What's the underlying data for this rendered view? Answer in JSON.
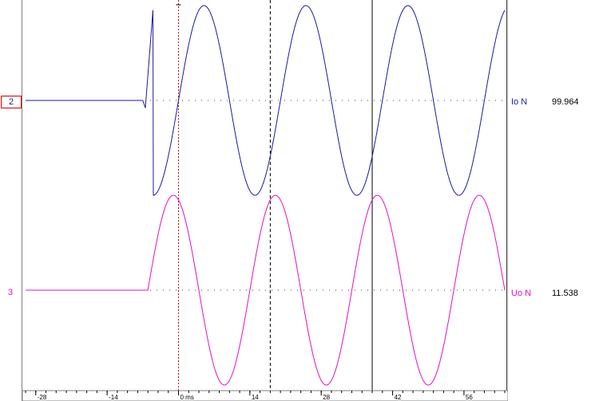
{
  "channels": [
    {
      "number": "2",
      "name": "Io N",
      "value": "99.964",
      "color": "#1a1aa0",
      "selected": true
    },
    {
      "number": "3",
      "name": "Uo N",
      "value": "11.538",
      "color": "#e010c8",
      "selected": false
    }
  ],
  "time_axis": {
    "unit_label": "ms",
    "ticks": [
      "-28",
      "-14",
      "0 ms",
      "14",
      "28",
      "42",
      "56"
    ],
    "range_ms": [
      -30,
      64
    ],
    "trigger_ms": 0,
    "cursor_dashed_ms": 18,
    "cursor_solid_ms": 38
  },
  "chart_data": {
    "type": "line",
    "xlabel": "",
    "xlim": [
      -30,
      64
    ],
    "cycle_ms": 20,
    "series": [
      {
        "name": "Io N",
        "onset_ms": -7,
        "pre_onset_level": 0,
        "amplitude": 1.0,
        "peaks": 4,
        "troughs": 4,
        "crossing_at_trigger": "falling"
      },
      {
        "name": "Uo N",
        "onset_ms": -6,
        "pre_onset_level": 0,
        "amplitude": 1.0,
        "peaks": 4,
        "troughs": 4,
        "first_peak_ms": -1
      }
    ]
  },
  "colors": {
    "trigger": "#c00000",
    "grid_dots": "#404040",
    "selection_box": "#d00000"
  }
}
